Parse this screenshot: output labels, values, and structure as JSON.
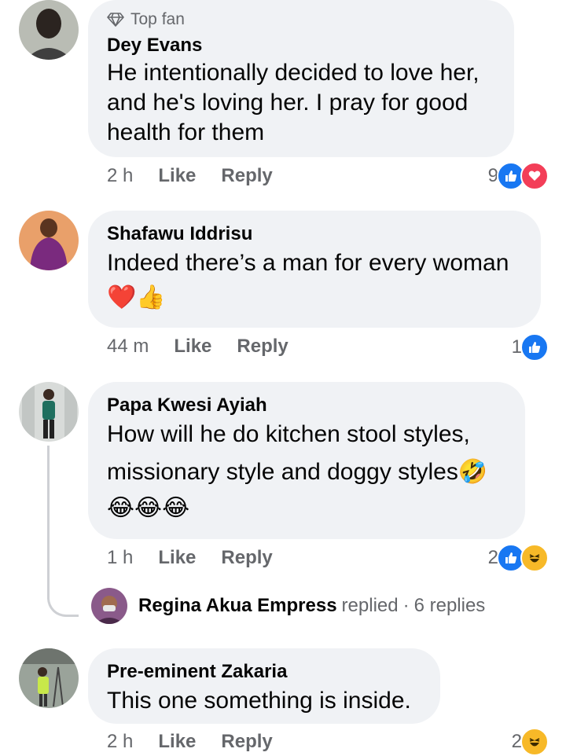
{
  "comments": [
    {
      "badge": "Top fan",
      "author": "Dey Evans",
      "text_lines": [
        "He intentionally decided to love her,",
        "and he's loving her. I pray for good",
        "health for them"
      ],
      "time": "2 h",
      "like": "Like",
      "reply": "Reply",
      "reaction_count": "9",
      "reactions": [
        "like-icon",
        "love-icon"
      ]
    },
    {
      "author": "Shafawu Iddrisu",
      "text_lines": [
        "Indeed there’s a man for every woman"
      ],
      "emoji_line": "❤️👍",
      "time": "44 m",
      "like": "Like",
      "reply": "Reply",
      "reaction_count": "1",
      "reactions": [
        "like-icon"
      ]
    },
    {
      "author": "Papa Kwesi Ayiah",
      "text_lines": [
        "How will he do kitchen stool styles,",
        "missionary style and doggy styles🤣"
      ],
      "emoji_line": "😂😂😂",
      "time": "1 h",
      "like": "Like",
      "reply": "Reply",
      "reaction_count": "2",
      "reactions": [
        "like-icon",
        "haha-icon"
      ],
      "replies_summary": {
        "name": "Regina Akua Empress",
        "action": "replied",
        "separator": "·",
        "count_text": "6 replies"
      }
    },
    {
      "author": "Pre-eminent Zakaria",
      "text_lines": [
        "This one something is inside."
      ],
      "time": "2 h",
      "like": "Like",
      "reply": "Reply",
      "reaction_count": "2",
      "reactions": [
        "haha-icon"
      ]
    }
  ],
  "colors": {
    "bubble": "#f0f2f5",
    "secondary_text": "#65676b",
    "like_blue": "#1877f2",
    "love_red": "#f33e58",
    "haha_yellow": "#f7b928"
  }
}
